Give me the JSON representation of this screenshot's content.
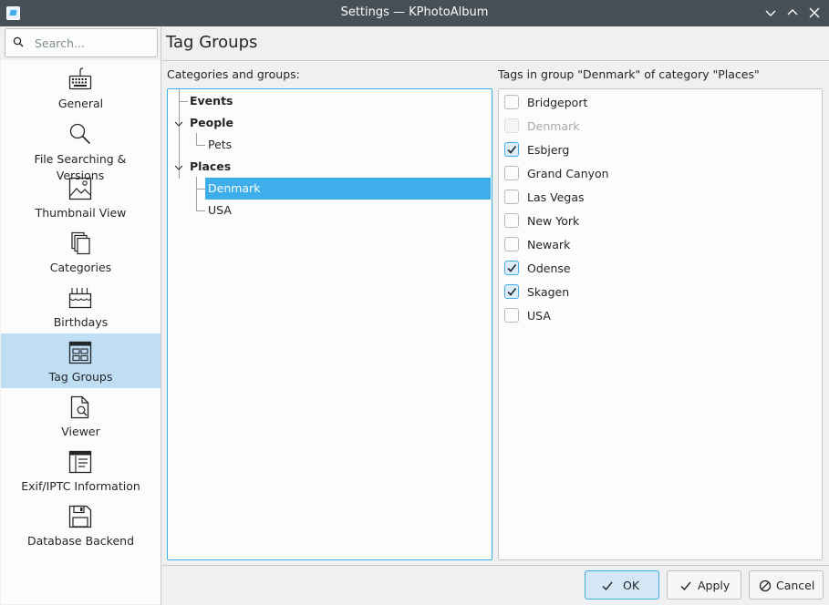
{
  "window": {
    "title": "Settings — KPhotoAlbum",
    "controls": [
      "minimize-icon",
      "maximize-icon",
      "close-icon"
    ]
  },
  "sidebar": {
    "search": {
      "placeholder": "Search..."
    },
    "items": [
      {
        "id": "general",
        "label": "General",
        "icon": "keyboard-icon"
      },
      {
        "id": "file-searching",
        "label": "File Searching & Versions",
        "icon": "magnifier-icon"
      },
      {
        "id": "thumbnail-view",
        "label": "Thumbnail View",
        "icon": "image-icon"
      },
      {
        "id": "categories",
        "label": "Categories",
        "icon": "documents-icon"
      },
      {
        "id": "birthdays",
        "label": "Birthdays",
        "icon": "cake-icon"
      },
      {
        "id": "tag-groups",
        "label": "Tag Groups",
        "icon": "grid-icon",
        "selected": true
      },
      {
        "id": "viewer",
        "label": "Viewer",
        "icon": "document-search-icon"
      },
      {
        "id": "exif",
        "label": "Exif/IPTC Information",
        "icon": "info-table-icon"
      },
      {
        "id": "database",
        "label": "Database Backend",
        "icon": "floppy-icon"
      }
    ]
  },
  "main": {
    "title": "Tag Groups",
    "categories_label": "Categories and groups:",
    "tags_label": "Tags in group \"Denmark\" of category \"Places\"",
    "tree": {
      "events": "Events",
      "people": "People",
      "pets": "Pets",
      "places": "Places",
      "denmark": "Denmark",
      "usa": "USA"
    },
    "tags": [
      {
        "label": "Bridgeport",
        "checked": false,
        "disabled": false
      },
      {
        "label": "Denmark",
        "checked": false,
        "disabled": true
      },
      {
        "label": "Esbjerg",
        "checked": true,
        "disabled": false
      },
      {
        "label": "Grand Canyon",
        "checked": false,
        "disabled": false
      },
      {
        "label": "Las Vegas",
        "checked": false,
        "disabled": false
      },
      {
        "label": "New York",
        "checked": false,
        "disabled": false
      },
      {
        "label": "Newark",
        "checked": false,
        "disabled": false
      },
      {
        "label": "Odense",
        "checked": true,
        "disabled": false
      },
      {
        "label": "Skagen",
        "checked": true,
        "disabled": false
      },
      {
        "label": "USA",
        "checked": false,
        "disabled": false
      }
    ]
  },
  "footer": {
    "ok": "OK",
    "apply": "Apply",
    "cancel": "Cancel"
  },
  "colors": {
    "accent": "#3daee9",
    "selection_light": "#bfdef3",
    "titlebar": "#475057"
  }
}
